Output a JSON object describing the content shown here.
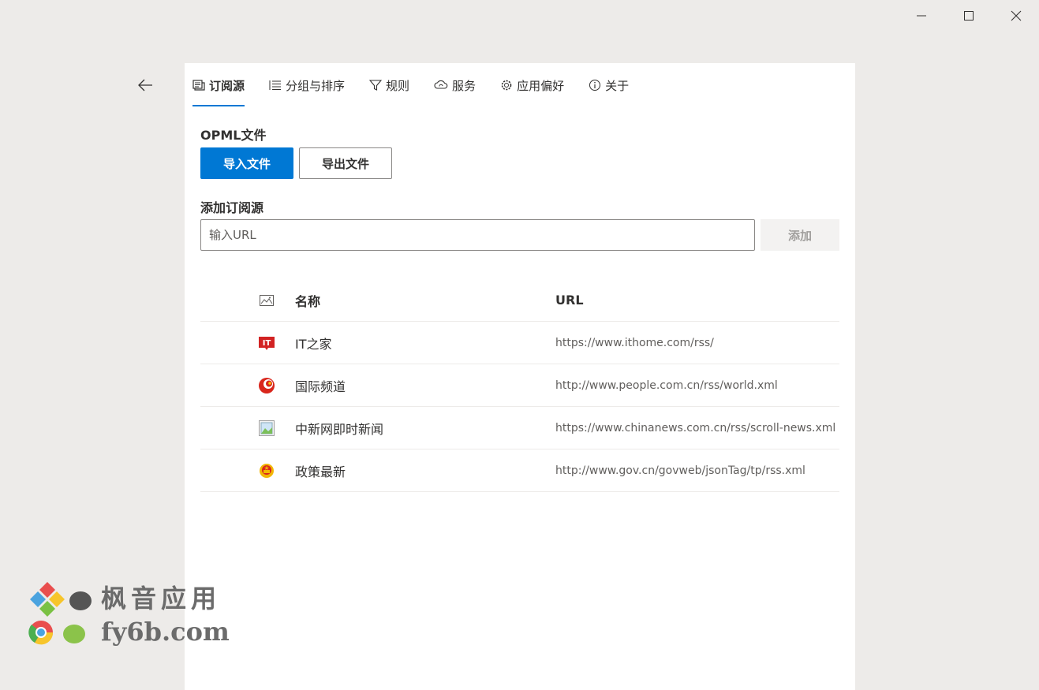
{
  "window_controls": {
    "minimize_icon": "minimize-icon",
    "maximize_icon": "maximize-icon",
    "close_icon": "close-icon"
  },
  "nav": {
    "back_icon": "back-arrow-icon"
  },
  "tabs": [
    {
      "label": "订阅源",
      "icon": "feed-icon",
      "active": true
    },
    {
      "label": "分组与排序",
      "icon": "list-icon",
      "active": false
    },
    {
      "label": "规则",
      "icon": "filter-icon",
      "active": false
    },
    {
      "label": "服务",
      "icon": "cloud-sync-icon",
      "active": false
    },
    {
      "label": "应用偏好",
      "icon": "gear-icon",
      "active": false
    },
    {
      "label": "关于",
      "icon": "info-icon",
      "active": false
    }
  ],
  "opml": {
    "title": "OPML文件",
    "import_label": "导入文件",
    "export_label": "导出文件"
  },
  "add_source": {
    "title": "添加订阅源",
    "placeholder": "输入URL",
    "value": "",
    "add_label": "添加"
  },
  "table": {
    "header": {
      "icon": "image-icon",
      "name": "名称",
      "url": "URL"
    },
    "rows": [
      {
        "icon": "ithome-logo-icon",
        "name": "IT之家",
        "url": "https://www.ithome.com/rss/"
      },
      {
        "icon": "people-logo-icon",
        "name": "国际频道",
        "url": "http://www.people.com.cn/rss/world.xml"
      },
      {
        "icon": "broken-image-icon",
        "name": "中新网即时新闻",
        "url": "https://www.chinanews.com.cn/rss/scroll-news.xml"
      },
      {
        "icon": "national-emblem-icon",
        "name": "政策最新",
        "url": "http://www.gov.cn/govweb/jsonTag/tp/rss.xml"
      }
    ]
  },
  "watermark": {
    "line1": "枫音应用",
    "line2": "fy6b.com"
  },
  "colors": {
    "accent": "#0078d4",
    "background": "#edebe9",
    "panel": "#ffffff"
  }
}
